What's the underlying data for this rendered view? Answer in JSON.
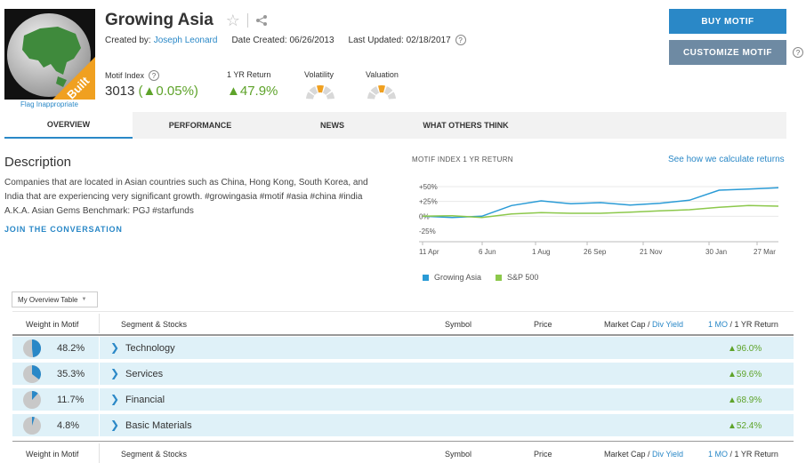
{
  "motif": {
    "title": "Growing Asia",
    "badge": "Built",
    "flag_link": "Flag Inappropriate",
    "created_by_label": "Created by:",
    "created_by": "Joseph Leonard",
    "date_created_label": "Date Created:",
    "date_created": "06/26/2013",
    "last_updated_label": "Last Updated:",
    "last_updated": "02/18/2017"
  },
  "stats": {
    "index_label": "Motif Index",
    "index_value": "3013",
    "index_change": "(▲0.05%)",
    "return_label": "1 YR Return",
    "return_value": "▲47.9%",
    "volatility_label": "Volatility",
    "volatility_level": 0.4,
    "valuation_label": "Valuation",
    "valuation_level": 0.45
  },
  "actions": {
    "buy": "BUY MOTIF",
    "customize": "CUSTOMIZE MOTIF"
  },
  "tabs": [
    "OVERVIEW",
    "PERFORMANCE",
    "NEWS",
    "WHAT OTHERS THINK"
  ],
  "description": {
    "heading": "Description",
    "text": "Companies that are located in Asian countries such as China, Hong Kong, South Korea, and India that are experiencing very significant growth. #growingasia #motif #asia #china #india A.K.A. Asian Gems Benchmark: PGJ #starfunds",
    "join": "JOIN THE CONVERSATION"
  },
  "chart_header": {
    "title": "MOTIF INDEX 1 YR RETURN",
    "link": "See how we calculate returns"
  },
  "chart_data": {
    "type": "line",
    "x": [
      "11 Apr",
      "6 Jun",
      "1 Aug",
      "26 Sep",
      "21 Nov",
      "30 Jan",
      "27 Mar"
    ],
    "yticks": [
      "+50%",
      "+25%",
      "0%",
      "-25%"
    ],
    "ylim": [
      -25,
      50
    ],
    "series": [
      {
        "name": "Growing Asia",
        "color": "#2a9bd6",
        "values": [
          0,
          -2,
          0,
          18,
          26,
          21,
          23,
          19,
          22,
          27,
          44,
          46,
          48
        ]
      },
      {
        "name": "S&P 500",
        "color": "#8cc84b",
        "values": [
          0,
          1,
          -2,
          4,
          6,
          5,
          5,
          7,
          9,
          11,
          15,
          18,
          17
        ]
      }
    ]
  },
  "table": {
    "dropdown": "My Overview Table",
    "headers": {
      "weight": "Weight in Motif",
      "segment": "Segment & Stocks",
      "symbol": "Symbol",
      "price": "Price",
      "mktcap": "Market Cap /",
      "divyield": "Div Yield",
      "onemo": "1 MO",
      "oneyr": "/ 1 YR Return"
    },
    "rows": [
      {
        "weight": "48.2%",
        "weight_frac": 0.482,
        "segment": "Technology",
        "ret": "▲96.0%"
      },
      {
        "weight": "35.3%",
        "weight_frac": 0.353,
        "segment": "Services",
        "ret": "▲59.6%"
      },
      {
        "weight": "11.7%",
        "weight_frac": 0.117,
        "segment": "Financial",
        "ret": "▲68.9%"
      },
      {
        "weight": "4.8%",
        "weight_frac": 0.048,
        "segment": "Basic Materials",
        "ret": "▲52.4%"
      }
    ]
  }
}
